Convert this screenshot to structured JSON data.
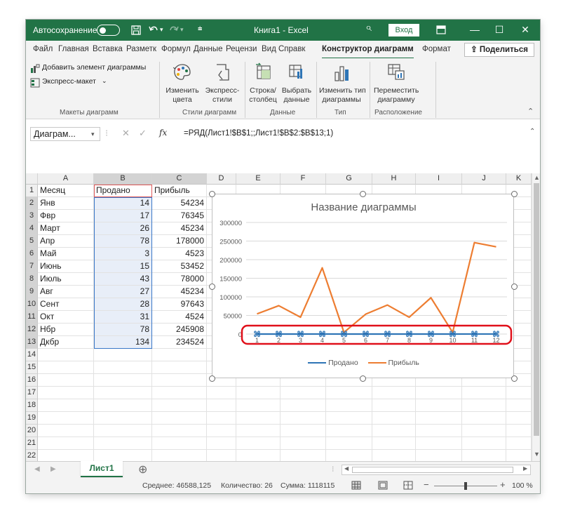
{
  "titlebar": {
    "autosave_label": "Автосохранение",
    "filename": "Книга1 - Excel",
    "signin": "Вход",
    "search_glyph": "⌕"
  },
  "tabs": [
    {
      "label": "Файл"
    },
    {
      "label": "Главная"
    },
    {
      "label": "Вставка"
    },
    {
      "label": "Разметк"
    },
    {
      "label": "Формул"
    },
    {
      "label": "Данные"
    },
    {
      "label": "Рецензи"
    },
    {
      "label": "Вид"
    },
    {
      "label": "Справк"
    },
    {
      "label": "Конструктор диаграмм"
    },
    {
      "label": "Формат"
    }
  ],
  "share_label": "Поделиться",
  "ribbon": {
    "add_element": "Добавить элемент диаграммы",
    "quick_layout": "Экспресс-макет",
    "change_colors": [
      "Изменить",
      "цвета"
    ],
    "quick_styles": [
      "Экспресс-",
      "стили"
    ],
    "switch_rowcol": [
      "Строка/",
      "столбец"
    ],
    "select_data": [
      "Выбрать",
      "данные"
    ],
    "change_type": [
      "Изменить тип",
      "диаграммы"
    ],
    "move_chart": [
      "Переместить",
      "диаграмму"
    ],
    "groups": [
      "Макеты диаграмм",
      "Стили диаграмм",
      "Данные",
      "Тип",
      "Расположение"
    ]
  },
  "formula_bar": {
    "name_box": "Диаграм...",
    "formula": "=РЯД(Лист1!$B$1;;Лист1!$B$2:$B$13;1)"
  },
  "columns": [
    "A",
    "B",
    "C",
    "D",
    "E",
    "F",
    "G",
    "H",
    "I",
    "J",
    "K"
  ],
  "rows": [
    "1",
    "2",
    "3",
    "4",
    "5",
    "6",
    "7",
    "8",
    "9",
    "10",
    "11",
    "12",
    "13",
    "14",
    "15",
    "16",
    "17",
    "18",
    "19",
    "20",
    "21",
    "22"
  ],
  "table": {
    "headers": [
      "Месяц",
      "Продано",
      "Прибыль"
    ],
    "data": [
      [
        "Янв",
        "14",
        "54234"
      ],
      [
        "Фвр",
        "17",
        "76345"
      ],
      [
        "Март",
        "26",
        "45234"
      ],
      [
        "Апр",
        "78",
        "178000"
      ],
      [
        "Май",
        "3",
        "4523"
      ],
      [
        "Июнь",
        "15",
        "53452"
      ],
      [
        "Июль",
        "43",
        "78000"
      ],
      [
        "Авг",
        "27",
        "45234"
      ],
      [
        "Сент",
        "28",
        "97643"
      ],
      [
        "Окт",
        "31",
        "4524"
      ],
      [
        "Нбр",
        "78",
        "245908"
      ],
      [
        "Дкбр",
        "134",
        "234524"
      ]
    ]
  },
  "chart_data": {
    "type": "line",
    "title": "Название диаграммы",
    "x": [
      1,
      2,
      3,
      4,
      5,
      6,
      7,
      8,
      9,
      10,
      11,
      12
    ],
    "series": [
      {
        "name": "Продано",
        "color": "#2e75b6",
        "values": [
          14,
          17,
          26,
          78,
          3,
          15,
          43,
          27,
          28,
          31,
          78,
          134
        ]
      },
      {
        "name": "Прибыль",
        "color": "#ed7d31",
        "values": [
          54234,
          76345,
          45234,
          178000,
          4523,
          53452,
          78000,
          45234,
          97643,
          4524,
          245908,
          234524
        ]
      }
    ],
    "ylim": [
      0,
      300000
    ],
    "yticks": [
      "300000",
      "250000",
      "200000",
      "150000",
      "100000",
      "50000",
      "0"
    ],
    "legend_position": "bottom",
    "grid": true,
    "highlight_color": "#e0101a"
  },
  "sheet_tab": "Лист1",
  "status": {
    "average": "Среднее: 46588,125",
    "count": "Количество: 26",
    "sum": "Сумма: 1118115",
    "zoom": "100 %"
  }
}
